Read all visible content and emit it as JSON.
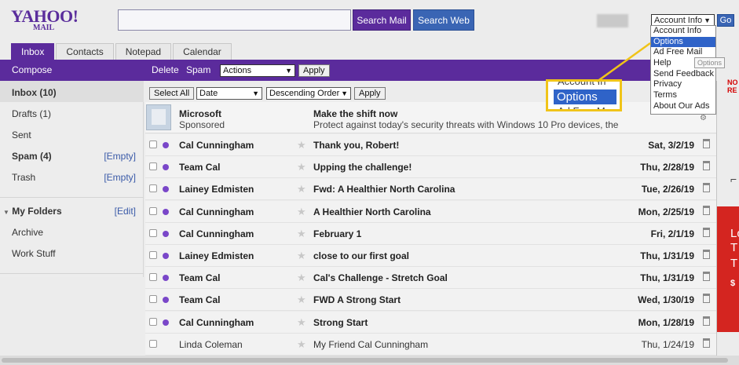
{
  "header": {
    "logo_line1": "YAHOO!",
    "logo_line2": "MAIL",
    "search_placeholder": "",
    "search_mail_label": "Search Mail",
    "search_web_label": "Search Web",
    "account_select_value": "Account Info",
    "go_label": "Go"
  },
  "account_menu": {
    "items": [
      "Account Info",
      "Options",
      "Ad Free Mail",
      "Help",
      "Send Feedback",
      "Privacy",
      "Terms",
      "About Our Ads"
    ],
    "selected_index": 1,
    "tooltip": "Options"
  },
  "tabs": [
    {
      "label": "Inbox",
      "active": true
    },
    {
      "label": "Contacts",
      "active": false
    },
    {
      "label": "Notepad",
      "active": false
    },
    {
      "label": "Calendar",
      "active": false
    }
  ],
  "toolbar": {
    "compose": "Compose",
    "delete": "Delete",
    "spam": "Spam",
    "actions_value": "Actions",
    "apply": "Apply"
  },
  "leftnav": {
    "folders": [
      {
        "label": "Inbox (10)",
        "bold": true,
        "empty": ""
      },
      {
        "label": "Drafts (1)",
        "bold": false,
        "empty": ""
      },
      {
        "label": "Sent",
        "bold": false,
        "empty": ""
      },
      {
        "label": "Spam (4)",
        "bold": true,
        "empty": "[Empty]"
      },
      {
        "label": "Trash",
        "bold": false,
        "empty": "[Empty]"
      }
    ],
    "my_folders_label": "My Folders",
    "edit_label": "[Edit]",
    "custom_folders": [
      "Archive",
      "Work Stuff"
    ]
  },
  "list_toolbar": {
    "select_all": "Select All",
    "sort_field": "Date",
    "sort_order": "Descending Order",
    "apply": "Apply"
  },
  "ad": {
    "sender": "Microsoft",
    "sponsored": "Sponsored",
    "subject": "Make the shift now",
    "body": "Protect against today's security threats with Windows 10 Pro devices, the"
  },
  "messages": [
    {
      "from": "Cal Cunningham",
      "subject": "Thank you, Robert!",
      "date": "Sat, 3/2/19",
      "unread": true
    },
    {
      "from": "Team Cal",
      "subject": "Upping the challenge!",
      "date": "Thu, 2/28/19",
      "unread": true
    },
    {
      "from": "Lainey Edmisten",
      "subject": "Fwd: A Healthier North Carolina",
      "date": "Tue, 2/26/19",
      "unread": true
    },
    {
      "from": "Cal Cunningham",
      "subject": "A Healthier North Carolina",
      "date": "Mon, 2/25/19",
      "unread": true
    },
    {
      "from": "Cal Cunningham",
      "subject": "February 1",
      "date": "Fri, 2/1/19",
      "unread": true
    },
    {
      "from": "Lainey Edmisten",
      "subject": "close to our first goal",
      "date": "Thu, 1/31/19",
      "unread": true
    },
    {
      "from": "Team Cal",
      "subject": "Cal's Challenge - Stretch Goal",
      "date": "Thu, 1/31/19",
      "unread": true
    },
    {
      "from": "Team Cal",
      "subject": "FWD A Strong Start",
      "date": "Wed, 1/30/19",
      "unread": true
    },
    {
      "from": "Cal Cunningham",
      "subject": "Strong Start",
      "date": "Mon, 1/28/19",
      "unread": true
    },
    {
      "from": "Linda Coleman",
      "subject": "My Friend Cal Cunningham",
      "date": "Thu, 1/24/19",
      "unread": false
    }
  ],
  "callout": {
    "ghost_top": "Account In",
    "highlight": "Options",
    "ghost_bottom": "Ad Free M"
  },
  "right_ad": {
    "top_text": "NO",
    "top_text2": "RE",
    "red_lines": [
      "Lo",
      "T",
      "T",
      "$"
    ]
  },
  "colors": {
    "brand_purple": "#5b2b9c",
    "search_web_blue": "#3a65b4",
    "selection_blue": "#2f63c8",
    "callout_yellow": "#f0c419",
    "unread_dot": "#7a47c9"
  }
}
